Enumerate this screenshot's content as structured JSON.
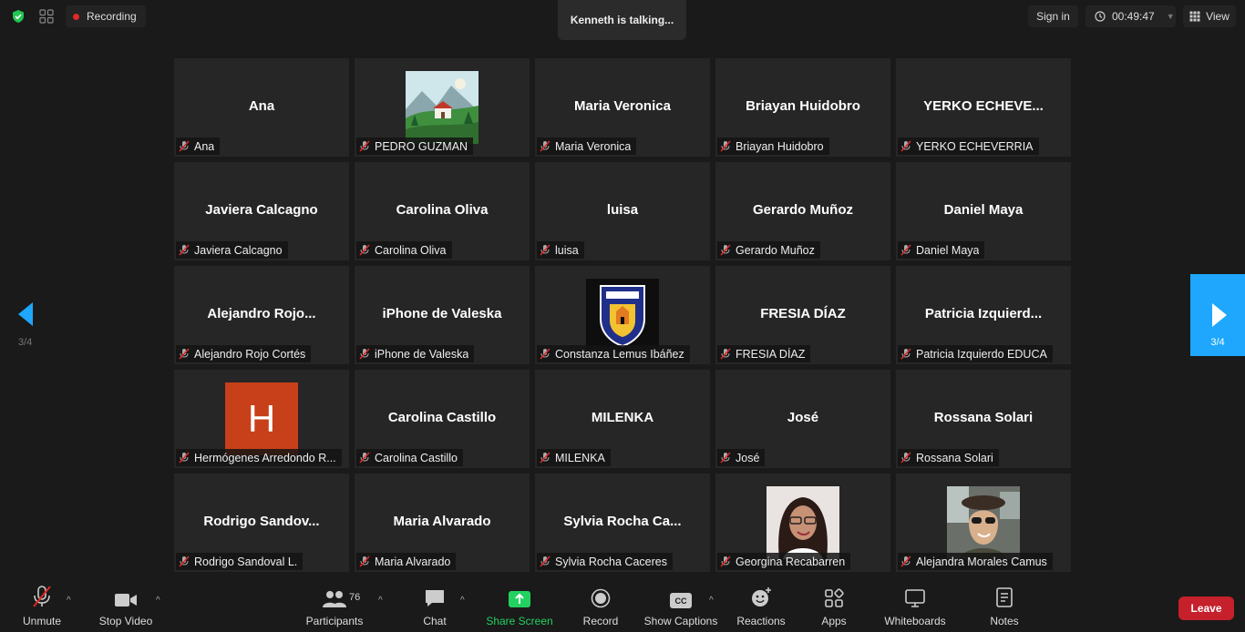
{
  "topbar": {
    "recording_label": "Recording",
    "talking_text": "Kenneth is talking...",
    "sign_in_label": "Sign in",
    "timer": "00:49:47",
    "view_label": "View"
  },
  "navigation": {
    "left_page": "3/4",
    "right_page": "3/4"
  },
  "tiles": [
    {
      "display_name": "Ana",
      "label": "Ana",
      "avatar": "none"
    },
    {
      "display_name": "",
      "label": "PEDRO GUZMAN",
      "avatar": "landscape-picture"
    },
    {
      "display_name": "Maria Veronica",
      "label": "Maria Veronica",
      "avatar": "none"
    },
    {
      "display_name": "Briayan Huidobro",
      "label": "Briayan Huidobro",
      "avatar": "none"
    },
    {
      "display_name": "YERKO  ECHEVE...",
      "label": "YERKO ECHEVERRIA",
      "avatar": "none"
    },
    {
      "display_name": "Javiera Calcagno",
      "label": "Javiera Calcagno",
      "avatar": "none"
    },
    {
      "display_name": "Carolina Oliva",
      "label": "Carolina Oliva",
      "avatar": "none"
    },
    {
      "display_name": "luisa",
      "label": "luisa",
      "avatar": "none"
    },
    {
      "display_name": "Gerardo Muñoz",
      "label": "Gerardo Muñoz",
      "avatar": "none"
    },
    {
      "display_name": "Daniel Maya",
      "label": "Daniel Maya",
      "avatar": "none"
    },
    {
      "display_name": "Alejandro  Rojo...",
      "label": "Alejandro Rojo Cortés",
      "avatar": "none"
    },
    {
      "display_name": "iPhone de Valeska",
      "label": "iPhone de Valeska",
      "avatar": "none"
    },
    {
      "display_name": "",
      "label": "Constanza Lemus Ibáñez",
      "avatar": "school-crest-picture"
    },
    {
      "display_name": "FRESIA DÍAZ",
      "label": "FRESIA DÍAZ",
      "avatar": "none"
    },
    {
      "display_name": "Patricia  Izquierd...",
      "label": "Patricia Izquierdo EDUCA",
      "avatar": "none"
    },
    {
      "display_name": "",
      "label": "Hermógenes Arredondo R...",
      "avatar": "letter-h"
    },
    {
      "display_name": "Carolina Castillo",
      "label": "Carolina Castillo",
      "avatar": "none"
    },
    {
      "display_name": "MILENKA",
      "label": "MILENKA",
      "avatar": "none"
    },
    {
      "display_name": "José",
      "label": "José",
      "avatar": "none"
    },
    {
      "display_name": "Rossana Solari",
      "label": "Rossana Solari",
      "avatar": "none"
    },
    {
      "display_name": "Rodrigo  Sandov...",
      "label": "Rodrigo Sandoval L.",
      "avatar": "none"
    },
    {
      "display_name": "Maria Alvarado",
      "label": "Maria Alvarado",
      "avatar": "none"
    },
    {
      "display_name": "Sylvia  Rocha  Ca...",
      "label": "Sylvia Rocha Caceres",
      "avatar": "none"
    },
    {
      "display_name": "",
      "label": "Georgina Recabarren",
      "avatar": "photo-woman-glasses"
    },
    {
      "display_name": "",
      "label": "Alejandra Morales Camus",
      "avatar": "photo-woman-car"
    }
  ],
  "avatar_letter": "H",
  "toolbar": {
    "unmute": "Unmute",
    "stop_video": "Stop Video",
    "participants": "Participants",
    "participants_count": "76",
    "chat": "Chat",
    "share_screen": "Share Screen",
    "record": "Record",
    "captions_badge": "CC",
    "show_captions": "Show Captions",
    "reactions": "Reactions",
    "apps": "Apps",
    "whiteboards": "Whiteboards",
    "notes": "Notes",
    "leave": "Leave"
  },
  "colors": {
    "background": "#1a1a1a",
    "tile": "#262626",
    "accent_blue": "#1ea7fd",
    "share_green": "#23d160",
    "leave_red": "#c5202b",
    "muted_red": "#e02828",
    "letter_avatar": "#c8401a"
  }
}
